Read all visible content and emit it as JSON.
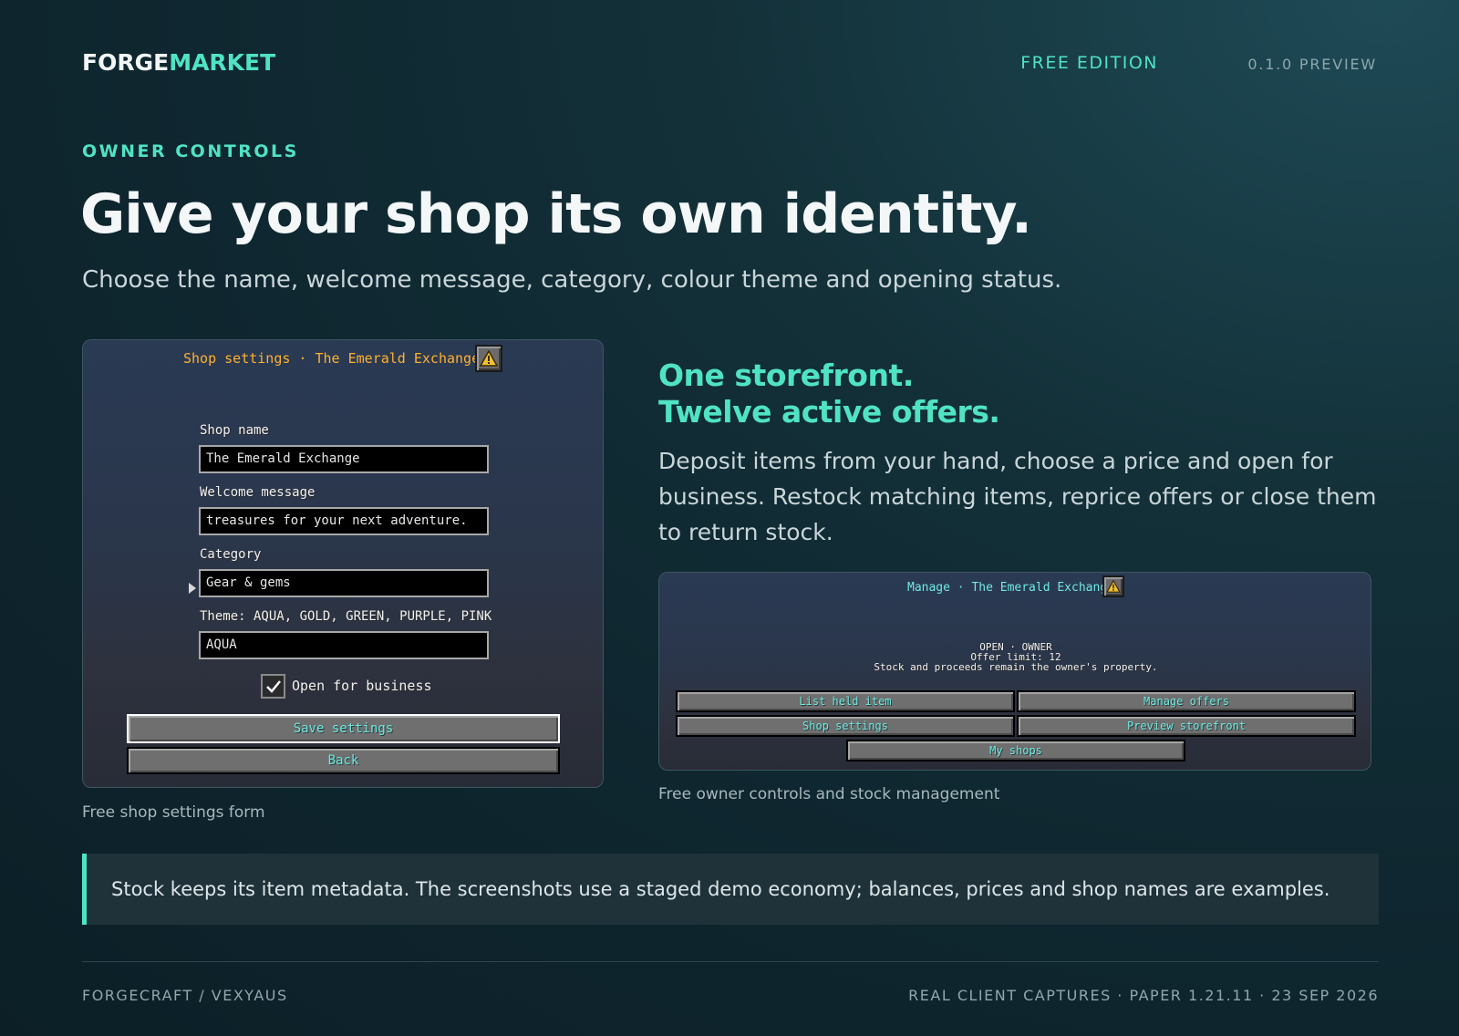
{
  "header": {
    "brand_part1": "FORGE",
    "brand_part2": "MARKET",
    "edition": "FREE EDITION",
    "version": "0.1.0 PREVIEW"
  },
  "hero": {
    "eyebrow": "OWNER CONTROLS",
    "headline": "Give your shop its own identity.",
    "subhead": "Choose the name, welcome message, category, colour theme and opening status."
  },
  "settings_gui": {
    "title": "Shop settings · The Emerald Exchange",
    "shop_name_label": "Shop name",
    "shop_name_value": "The Emerald Exchange",
    "welcome_label": "Welcome message",
    "welcome_value": "treasures for your next adventure.",
    "category_label": "Category",
    "category_value": "Gear & gems",
    "theme_label": "Theme: AQUA, GOLD, GREEN, PURPLE, PINK",
    "theme_value": "AQUA",
    "open_label": "Open for business",
    "open_checked": true,
    "save_label": "Save settings",
    "back_label": "Back",
    "caption": "Free shop settings form"
  },
  "storefront": {
    "heading_line1": "One storefront.",
    "heading_line2": "Twelve active offers.",
    "body": "Deposit items from your hand, choose a price and open for business. Restock matching items, reprice offers or close them to return stock."
  },
  "manage_gui": {
    "title": "Manage · The Emerald Exchange",
    "status_line1": "OPEN · OWNER",
    "status_line2": "Offer limit: 12",
    "status_line3": "Stock and proceeds remain the owner's property.",
    "buttons": {
      "list_held_item": "List held item",
      "manage_offers": "Manage offers",
      "shop_settings": "Shop settings",
      "preview_storefront": "Preview storefront",
      "my_shops": "My shops"
    },
    "caption": "Free owner controls and stock management"
  },
  "note": "Stock keeps its item metadata. The screenshots use a staged demo economy; balances, prices and shop names are examples.",
  "footer": {
    "left": "FORGECRAFT / VEXYAUS",
    "right": "REAL CLIENT CAPTURES · PAPER 1.21.11 · 23 SEP 2026"
  },
  "colors": {
    "accent": "#4fe3c4",
    "gui_title_gold": "#ffb02e",
    "gui_button_text": "#6fe8e0"
  }
}
